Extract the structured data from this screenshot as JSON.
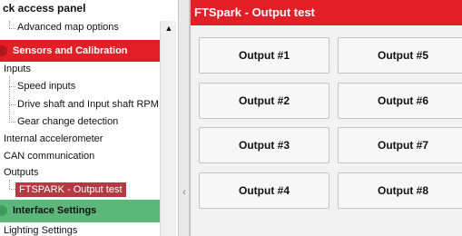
{
  "left_panel": {
    "title": "ck access panel",
    "advanced_item": "Advanced map options",
    "scroll_up_glyph": "▲",
    "sections": {
      "sensors": "Sensors and Calibration",
      "interface": "Interface Settings"
    },
    "items": {
      "inputs": "Inputs",
      "speed_inputs": "Speed inputs",
      "drive_shaft": "Drive shaft and Input shaft RPM",
      "gear_change": "Gear change detection",
      "accelerometer": "Internal accelerometer",
      "can": "CAN communication",
      "outputs": "Outputs",
      "output_test": "FTSPARK - Output test",
      "lighting": "Lighting Settings"
    }
  },
  "right_panel": {
    "title": "FTSpark - Output test",
    "buttons": {
      "o1": "Output #1",
      "o2": "Output #2",
      "o3": "Output #3",
      "o4": "Output #4",
      "o5": "Output #5",
      "o6": "Output #6",
      "o7": "Output #7",
      "o8": "Output #8"
    }
  },
  "splitter": {
    "glyph": "‹"
  },
  "colors": {
    "accent_red": "#e21f26",
    "selected_item": "#b23a43",
    "interface_green": "#5cb87a"
  }
}
